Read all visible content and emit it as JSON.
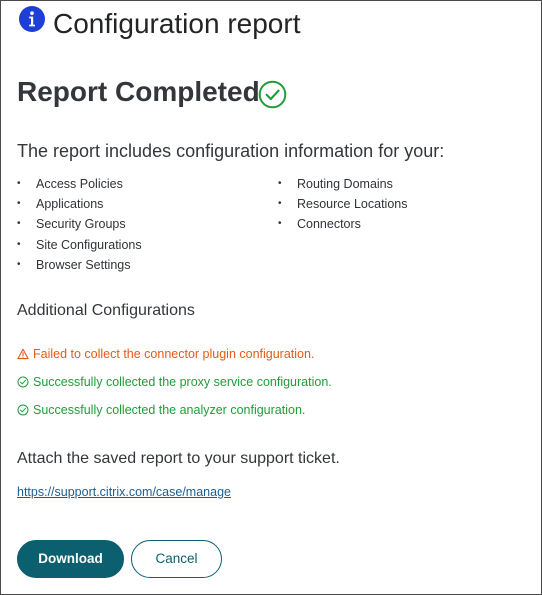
{
  "dialog": {
    "title": "Configuration report",
    "header_icon": "info-icon"
  },
  "report": {
    "heading": "Report Completed",
    "status_icon": "check-circle-icon",
    "intro": "The report includes configuration information for your:",
    "items_left": [
      "Access Policies",
      "Applications",
      "Security Groups",
      "Site Configurations",
      "Browser Settings"
    ],
    "items_right": [
      "Routing Domains",
      "Resource Locations",
      "Connectors"
    ],
    "bullet": "•"
  },
  "additional": {
    "heading": "Additional Configurations",
    "statuses": [
      {
        "icon": "warning-icon",
        "text": "Failed to collect the connector plugin configuration.",
        "color": "#e35a1a"
      },
      {
        "icon": "check-circle-icon",
        "text": "Successfully collected the proxy service configuration.",
        "color": "#1f9d3a"
      },
      {
        "icon": "check-circle-icon",
        "text": "Successfully collected the analyzer configuration.",
        "color": "#1f9d3a"
      }
    ]
  },
  "support": {
    "instruction": "Attach the saved report to your support ticket.",
    "link_text": "https://support.citrix.com/case/manage"
  },
  "actions": {
    "download_label": "Download",
    "cancel_label": "Cancel"
  },
  "colors": {
    "accent": "#0c5f6f",
    "info_icon": "#1e3fd6",
    "success": "#1f9d3a",
    "warning": "#e35a1a",
    "link": "#1a5f8f"
  }
}
